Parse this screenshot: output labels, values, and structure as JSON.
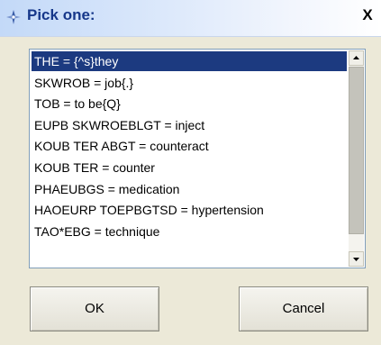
{
  "dialog": {
    "title": "Pick one:",
    "close_label": "X"
  },
  "list": {
    "selected_index": 0,
    "items": [
      "THE = {^s}they",
      "SKWROB = job{.}",
      "TOB = to be{Q}",
      "EUPB SKWROEBLGT = inject",
      "KOUB TER ABGT = counteract",
      "KOUB TER = counter",
      "PHAEUBGS = medication",
      "HAOEURP TOEPBGTSD = hypertension",
      "TAO*EBG = technique"
    ]
  },
  "buttons": {
    "ok_label": "OK",
    "cancel_label": "Cancel"
  },
  "colors": {
    "selection": "#1c3a80",
    "title_text": "#16378a"
  },
  "icons": {
    "app": "compass-icon",
    "close": "close-icon",
    "scroll_up": "chevron-up-icon",
    "scroll_down": "chevron-down-icon"
  }
}
